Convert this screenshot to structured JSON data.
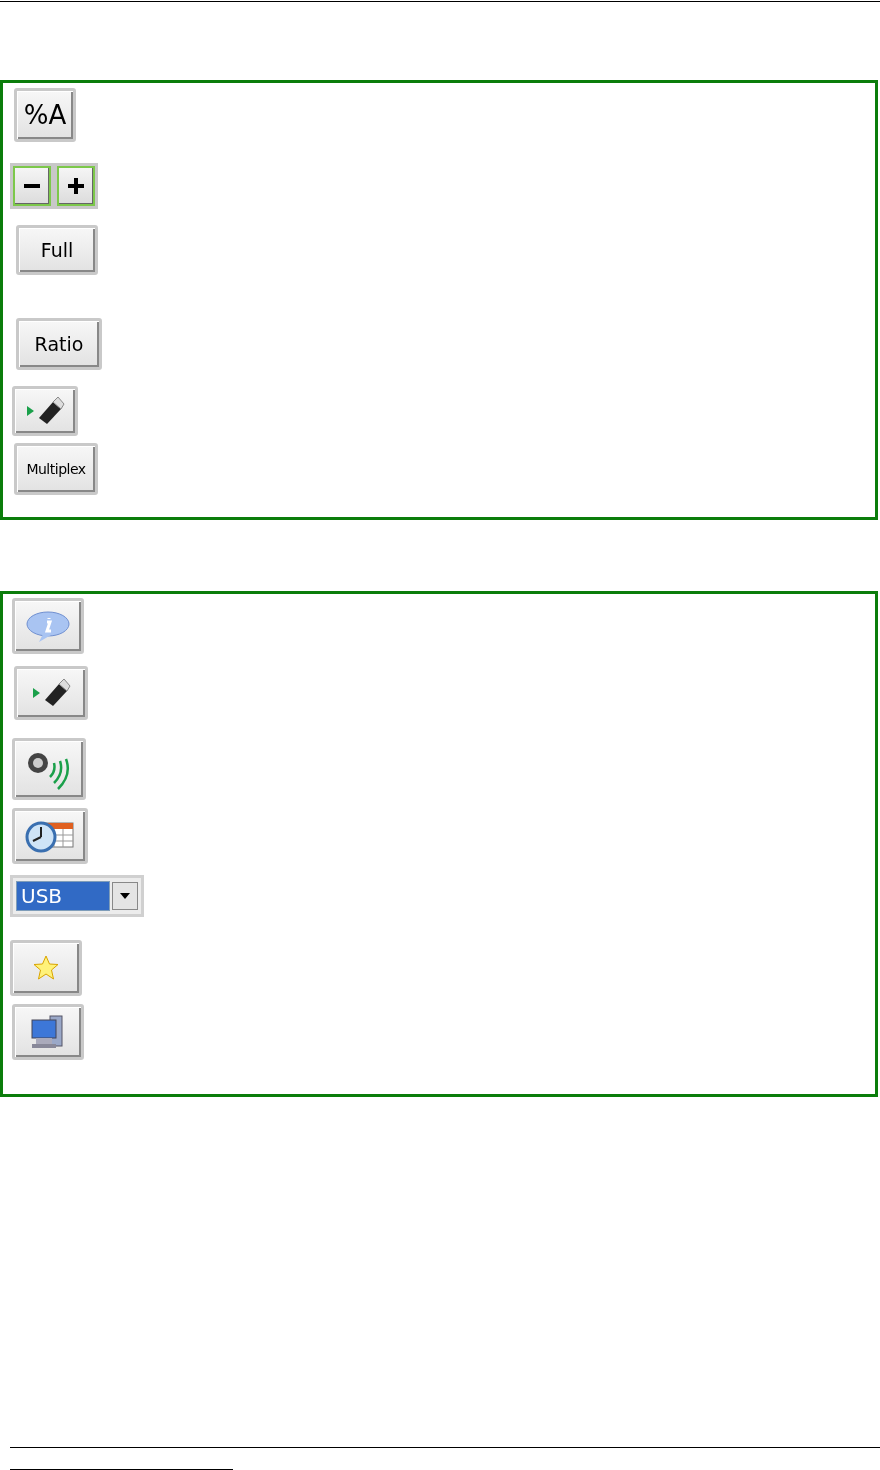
{
  "sections": [
    {
      "items": [
        {
          "kind": "text_button",
          "label": "%A"
        },
        {
          "kind": "zoom_buttons"
        },
        {
          "kind": "text_button",
          "label": "Full"
        },
        {
          "kind": "text_button",
          "label": "Ratio"
        },
        {
          "kind": "usb_button"
        },
        {
          "kind": "text_button",
          "label": "Multiplex"
        }
      ]
    },
    {
      "items": [
        {
          "kind": "info_button"
        },
        {
          "kind": "usb_button"
        },
        {
          "kind": "speaker_button"
        },
        {
          "kind": "schedule_button"
        },
        {
          "kind": "dropdown",
          "value": "USB"
        },
        {
          "kind": "star_button"
        },
        {
          "kind": "computer_button"
        }
      ]
    }
  ]
}
